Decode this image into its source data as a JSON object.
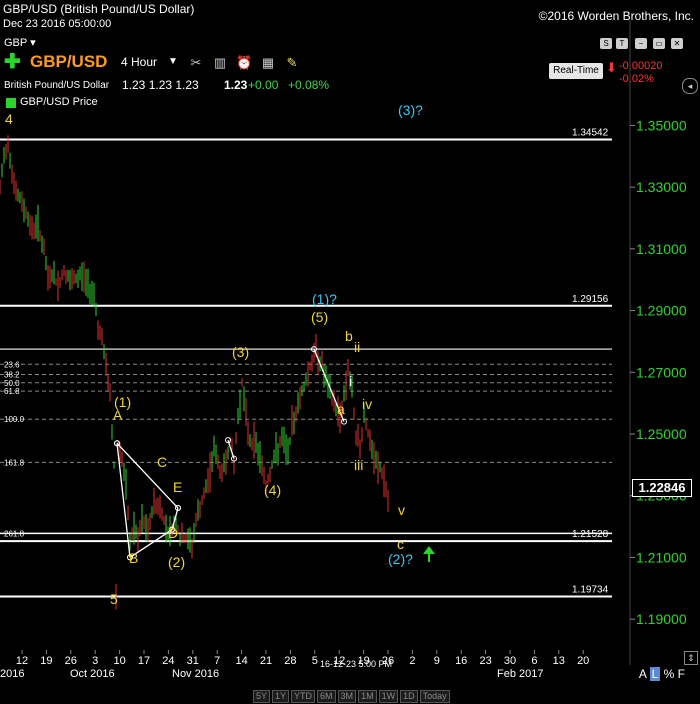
{
  "header": {
    "title": "GBP/USD (British Pound/US Dollar)",
    "date": "Dec 23 2016 05:00:00",
    "copyright": "©2016 Worden Brothers, Inc.",
    "symbol_dropdown": "GBP ▾",
    "symbol": "GBP/USD",
    "interval": "4 Hour",
    "name": "British Pound/US Dollar",
    "open_high_low": "1.23  1.23  1.23",
    "last": "1.23",
    "change": "+0.00",
    "change_pct": "+0.08%",
    "legend_label": "GBP/USD Price",
    "realtime_label": "Real-Time",
    "rt_change": "-0.00020",
    "rt_change_pct": "-0.02%"
  },
  "toolbar_icons": [
    "tools-icon",
    "bars-icon",
    "alarm-clock-icon",
    "grid-icon",
    "note-icon"
  ],
  "window_buttons": [
    "S",
    "T",
    "−",
    "▭",
    "✕"
  ],
  "chart_data": {
    "type": "candlestick",
    "title": "GBP/USD",
    "ylim": [
      1.18,
      1.355
    ],
    "y_ticks": [
      1.19,
      1.21,
      1.23,
      1.25,
      1.27,
      1.29,
      1.31,
      1.33,
      1.35
    ],
    "y_tick_labels": [
      "1.19000",
      "1.21000",
      "1.23000",
      "1.25000",
      "1.27000",
      "1.29000",
      "1.31000",
      "1.33000",
      "1.35000"
    ],
    "last_price_label": "1.22846",
    "last_price": 1.22846,
    "x_tick_labels": [
      "12",
      "19",
      "26",
      "3",
      "10",
      "17",
      "24",
      "31",
      "7",
      "14",
      "21",
      "28",
      "5",
      "12",
      "19",
      "26",
      "2",
      "9",
      "16",
      "23",
      "30",
      "6",
      "13",
      "20"
    ],
    "x_month_labels": [
      "2016",
      "Oct 2016",
      "Nov 2016",
      "Feb 2017"
    ],
    "date_marker": "16-12-23 5:00 PM",
    "horizontal_levels": [
      {
        "value": 1.34542,
        "label": "1.34542"
      },
      {
        "value": 1.29156,
        "label": "1.29156"
      },
      {
        "value": 1.21528,
        "label": "1.21528"
      },
      {
        "value": 1.19734,
        "label": "1.19734"
      }
    ],
    "fib_levels": [
      {
        "label": "23.6",
        "value": 1.2726
      },
      {
        "label": "38.2",
        "value": 1.2693
      },
      {
        "label": "50.0",
        "value": 1.2666
      },
      {
        "label": "61.8",
        "value": 1.2639
      },
      {
        "label": "100.0",
        "value": 1.2548
      },
      {
        "label": "161.8",
        "value": 1.2408
      },
      {
        "label": "261.8",
        "value": 1.2178
      }
    ],
    "wave_labels": [
      {
        "text": "4",
        "color": "yellow"
      },
      {
        "text": "(1)",
        "color": "yellow"
      },
      {
        "text": "A",
        "color": "yellow"
      },
      {
        "text": "C",
        "color": "yellow"
      },
      {
        "text": "E",
        "color": "yellow"
      },
      {
        "text": "B",
        "color": "yellow"
      },
      {
        "text": "D",
        "color": "yellow"
      },
      {
        "text": "(2)",
        "color": "yellow"
      },
      {
        "text": "5",
        "color": "yellow"
      },
      {
        "text": "(3)",
        "color": "yellow"
      },
      {
        "text": "(4)",
        "color": "yellow"
      },
      {
        "text": "(1)?",
        "color": "cyan"
      },
      {
        "text": "(5)",
        "color": "yellow"
      },
      {
        "text": "b",
        "color": "yellow"
      },
      {
        "text": "ii",
        "color": "yellow"
      },
      {
        "text": "i",
        "color": "white"
      },
      {
        "text": "a",
        "color": "yellow"
      },
      {
        "text": "iv",
        "color": "yellow"
      },
      {
        "text": "iii",
        "color": "yellow"
      },
      {
        "text": "v",
        "color": "yellow"
      },
      {
        "text": "c",
        "color": "yellow"
      },
      {
        "text": "(2)?",
        "color": "cyan"
      },
      {
        "text": "(3)?",
        "color": "cyan"
      }
    ],
    "price_path": [
      [
        0,
        1.329
      ],
      [
        4,
        1.34
      ],
      [
        8,
        1.345
      ],
      [
        12,
        1.335
      ],
      [
        16,
        1.328
      ],
      [
        20,
        1.326
      ],
      [
        26,
        1.322
      ],
      [
        32,
        1.316
      ],
      [
        38,
        1.318
      ],
      [
        44,
        1.309
      ],
      [
        48,
        1.3
      ],
      [
        52,
        1.302
      ],
      [
        58,
        1.298
      ],
      [
        64,
        1.303
      ],
      [
        70,
        1.299
      ],
      [
        76,
        1.3
      ],
      [
        82,
        1.302
      ],
      [
        88,
        1.298
      ],
      [
        94,
        1.296
      ],
      [
        98,
        1.285
      ],
      [
        102,
        1.28
      ],
      [
        106,
        1.272
      ],
      [
        110,
        1.262
      ],
      [
        114,
        1.24
      ],
      [
        116,
        1.198
      ],
      [
        118,
        1.246
      ],
      [
        122,
        1.242
      ],
      [
        126,
        1.232
      ],
      [
        130,
        1.215
      ],
      [
        134,
        1.22
      ],
      [
        138,
        1.215
      ],
      [
        142,
        1.222
      ],
      [
        148,
        1.218
      ],
      [
        154,
        1.228
      ],
      [
        160,
        1.226
      ],
      [
        166,
        1.22
      ],
      [
        170,
        1.218
      ],
      [
        176,
        1.222
      ],
      [
        180,
        1.216
      ],
      [
        186,
        1.216
      ],
      [
        192,
        1.214
      ],
      [
        196,
        1.222
      ],
      [
        200,
        1.226
      ],
      [
        206,
        1.232
      ],
      [
        210,
        1.238
      ],
      [
        214,
        1.246
      ],
      [
        218,
        1.24
      ],
      [
        222,
        1.237
      ],
      [
        226,
        1.242
      ],
      [
        230,
        1.248
      ],
      [
        234,
        1.24
      ],
      [
        238,
        1.256
      ],
      [
        242,
        1.267
      ],
      [
        246,
        1.255
      ],
      [
        250,
        1.248
      ],
      [
        256,
        1.247
      ],
      [
        262,
        1.24
      ],
      [
        266,
        1.233
      ],
      [
        270,
        1.238
      ],
      [
        276,
        1.244
      ],
      [
        282,
        1.248
      ],
      [
        288,
        1.244
      ],
      [
        292,
        1.252
      ],
      [
        298,
        1.26
      ],
      [
        304,
        1.266
      ],
      [
        310,
        1.272
      ],
      [
        316,
        1.277
      ],
      [
        322,
        1.272
      ],
      [
        328,
        1.265
      ],
      [
        334,
        1.26
      ],
      [
        340,
        1.256
      ],
      [
        344,
        1.262
      ],
      [
        348,
        1.272
      ],
      [
        352,
        1.263
      ],
      [
        356,
        1.25
      ],
      [
        360,
        1.245
      ],
      [
        364,
        1.257
      ],
      [
        368,
        1.25
      ],
      [
        372,
        1.244
      ],
      [
        376,
        1.24
      ],
      [
        380,
        1.239
      ],
      [
        384,
        1.235
      ],
      [
        388,
        1.228
      ],
      [
        390,
        1.229
      ]
    ]
  },
  "range_buttons": [
    "5Y",
    "1Y",
    "YTD",
    "6M",
    "3M",
    "1M",
    "1W",
    "1D",
    "Today"
  ],
  "scale_toggle": {
    "a": "A",
    "l": "L",
    "percent": "%",
    "f": "F"
  }
}
